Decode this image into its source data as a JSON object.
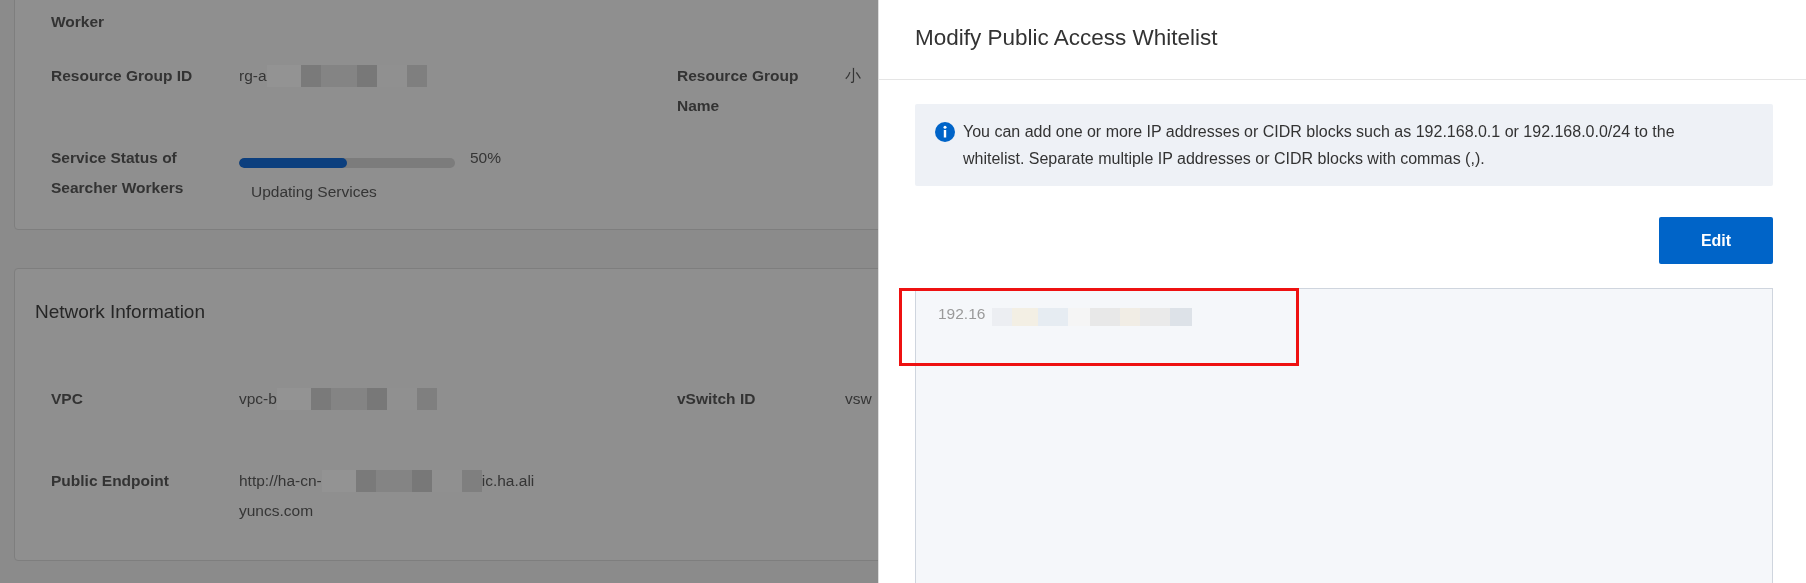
{
  "page": {
    "details_card": {
      "rows": [
        {
          "items": [
            {
              "kind": "text",
              "label": "Worker"
            }
          ]
        },
        {
          "items": [
            {
              "kind": "text",
              "label": "Resource Group ID",
              "value": "rg-a",
              "redacted": true
            },
            {
              "kind": "text",
              "label": "Resource Group Name",
              "value": "小"
            }
          ]
        },
        {
          "items": [
            {
              "kind": "progress",
              "label": "Service Status of Searcher Workers",
              "level": 0.5,
              "reading": "50%",
              "status": "Updating Services"
            }
          ]
        }
      ]
    },
    "network_card": {
      "title": "Network Information",
      "rows": [
        {
          "items": [
            {
              "kind": "text",
              "label": "VPC",
              "value": "vpc-b",
              "redacted": true
            },
            {
              "kind": "text",
              "label": "vSwitch ID",
              "value": "vsw"
            }
          ]
        },
        {
          "items": [
            {
              "kind": "text",
              "label": "Public Endpoint",
              "value": "http://ha-cn-",
              "value_end": "ic.ha.ali",
              "value_line2": "yuncs.com",
              "redacted": true
            }
          ]
        }
      ]
    }
  },
  "drawer": {
    "title": "Modify Public Access Whitelist",
    "notice": "You can add one or more IP addresses or CIDR blocks such as 192.168.0.1 or 192.168.0.0/24 to the whitelist. Separate multiple IP addresses or CIDR blocks with commas (,).",
    "edit_button": "Edit",
    "whitelist": {
      "value": "192.16",
      "disabled": true,
      "redacted": true,
      "highlighted": true
    }
  }
}
